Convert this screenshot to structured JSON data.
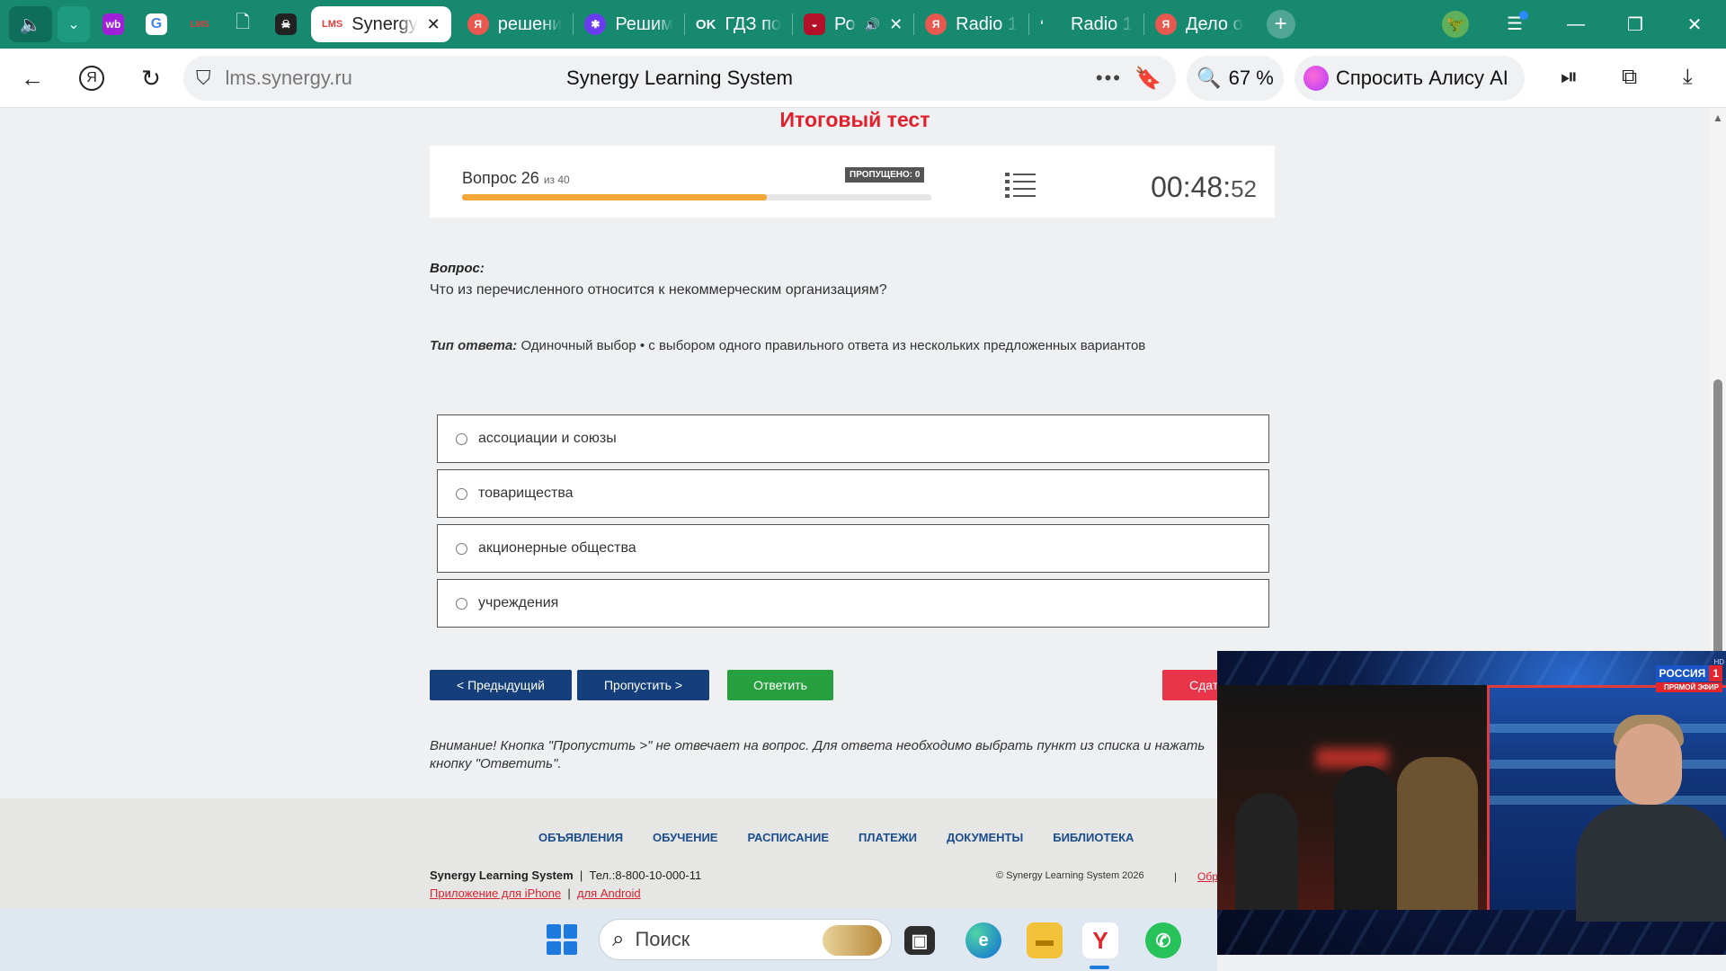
{
  "browser": {
    "tabs": [
      {
        "label": "Synergy",
        "active": true,
        "icon": "lms-favicon"
      },
      {
        "label": "решени",
        "icon": "yandex-favicon"
      },
      {
        "label": "Решим",
        "icon": "star-favicon"
      },
      {
        "label": "ГДЗ по",
        "icon": "ok-favicon"
      },
      {
        "label": "Ро",
        "icon": "lips-favicon"
      },
      {
        "label": "Radio 1",
        "icon": "yandex-favicon"
      },
      {
        "label": "Radio 1",
        "icon": "radio-favicon"
      },
      {
        "label": "Дело о",
        "icon": "yandex-favicon"
      }
    ],
    "pinned_badges": [
      "wb",
      "G",
      "LMS",
      "",
      ""
    ],
    "address": {
      "host": "lms.synergy.ru",
      "page_title": "Synergy Learning System",
      "zoom": "67 %",
      "alisa": "Спросить Алису AI"
    }
  },
  "test": {
    "title": "Итоговый тест",
    "question_label": "Вопрос 26",
    "question_total": "из 40",
    "skipped_badge": "ПРОПУЩЕНО: 0",
    "progress_fraction": 0.65,
    "timer_main": "00:48:",
    "timer_sec": "52",
    "question_heading": "Вопрос:",
    "question_text": "Что из перечисленного относится к некоммерческим организациям?",
    "answer_type_label": "Тип ответа:",
    "answer_type_text": "Одиночный выбор • с выбором одного правильного ответа из нескольких предложенных вариантов",
    "options": [
      "ассоциации и союзы",
      "товарищества",
      "акционерные общества",
      "учреждения"
    ],
    "buttons": {
      "prev": "< Предыдущий",
      "skip": "Пропустить >",
      "answer": "Ответить",
      "submit": "Сдать"
    },
    "warning": "Внимание! Кнопка \"Пропустить >\" не отвечает на вопрос. Для ответа необходимо выбрать пункт из списка и нажать кнопку \"Ответить\"."
  },
  "footer": {
    "nav": [
      "ОБЪЯВЛЕНИЯ",
      "ОБУЧЕНИЕ",
      "РАСПИСАНИЕ",
      "ПЛАТЕЖИ",
      "ДОКУМЕНТЫ",
      "БИБЛИОТЕКА"
    ],
    "brand": "Synergy Learning System",
    "phone": "Тел.:8-800-10-000-11",
    "iphone_link": "Приложение для iPhone",
    "android_link": "для Android",
    "copyright": "© Synergy Learning System 2026",
    "feedback": "Обр"
  },
  "video": {
    "channel": "РОССИЯ",
    "channel_num": "1",
    "live": "ПРЯМОЙ ЭФИР",
    "hd": "HD"
  },
  "taskbar": {
    "search_placeholder": "Поиск"
  },
  "colors": {
    "tabstrip": "#16896f",
    "title_red": "#e0202c",
    "nav_blue": "#143f7a",
    "answer_green": "#27a03f",
    "submit_red": "#e8354a",
    "progress_orange": "#f2a738"
  }
}
